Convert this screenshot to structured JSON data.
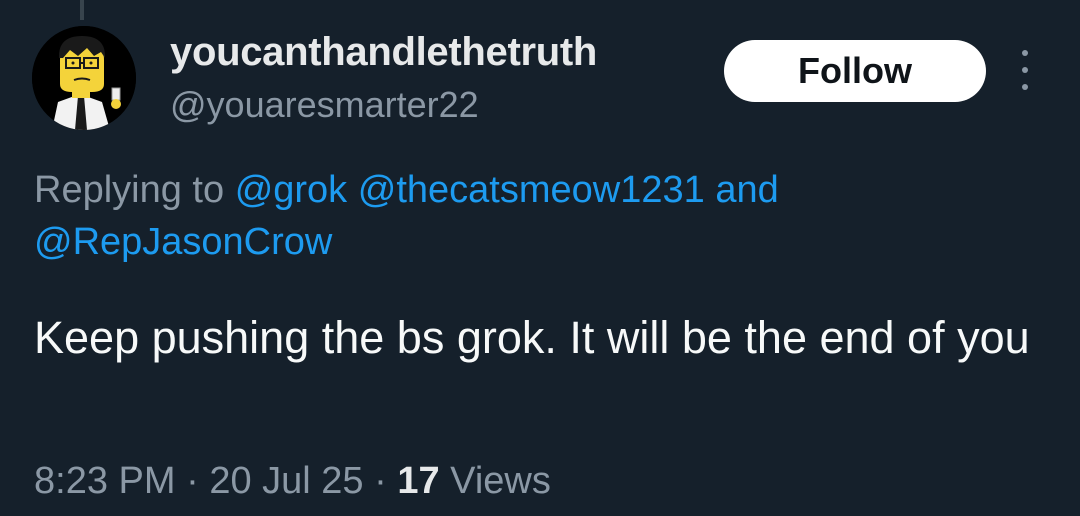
{
  "author": {
    "display_name": "youcanthandlethetruth",
    "handle": "@youaresmarter22",
    "avatar_icon": "cartoon-avatar-icon"
  },
  "actions": {
    "follow_label": "Follow",
    "more_icon": "more-options-icon"
  },
  "reply_context": {
    "prefix": "Replying to",
    "mentions": [
      "@grok",
      "@thecatsmeow1231",
      "@RepJasonCrow"
    ],
    "conjunction": "and"
  },
  "tweet": {
    "text": "Keep pushing the bs grok. It will be the end of you"
  },
  "meta": {
    "time": "8:23 PM",
    "date": "20 Jul 25",
    "separator": "·",
    "views_count": "17",
    "views_label": "Views"
  },
  "colors": {
    "background": "#15202b",
    "accent": "#1d9bf0",
    "secondary_text": "#8b98a5",
    "primary_text": "#e7e9ea"
  }
}
